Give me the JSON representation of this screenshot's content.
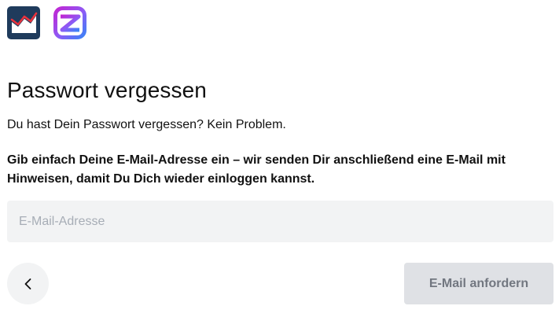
{
  "header": {
    "logos": [
      {
        "icon": "chart-app-logo-icon",
        "color": "#1f3b5c",
        "accent": "#e8323c"
      },
      {
        "icon": "z-app-logo-icon",
        "gradient": [
          "#c026d3",
          "#3b82f6"
        ]
      }
    ]
  },
  "main": {
    "title": "Passwort vergessen",
    "intro": "Du hast Dein Passwort vergessen? Kein Problem.",
    "description": "Gib einfach Deine E-Mail-Adresse ein – wir senden Dir anschließend eine E-Mail mit Hinweisen, damit Du Dich wieder einloggen kannst.",
    "email": {
      "placeholder": "E-Mail-Adresse",
      "value": ""
    }
  },
  "actions": {
    "back_icon": "chevron-left-icon",
    "submit_label": "E-Mail anfordern",
    "submit_disabled": true
  },
  "colors": {
    "field_bg": "#f2f3f4",
    "button_disabled_bg": "#dfe1e5",
    "button_disabled_text": "#727780"
  }
}
